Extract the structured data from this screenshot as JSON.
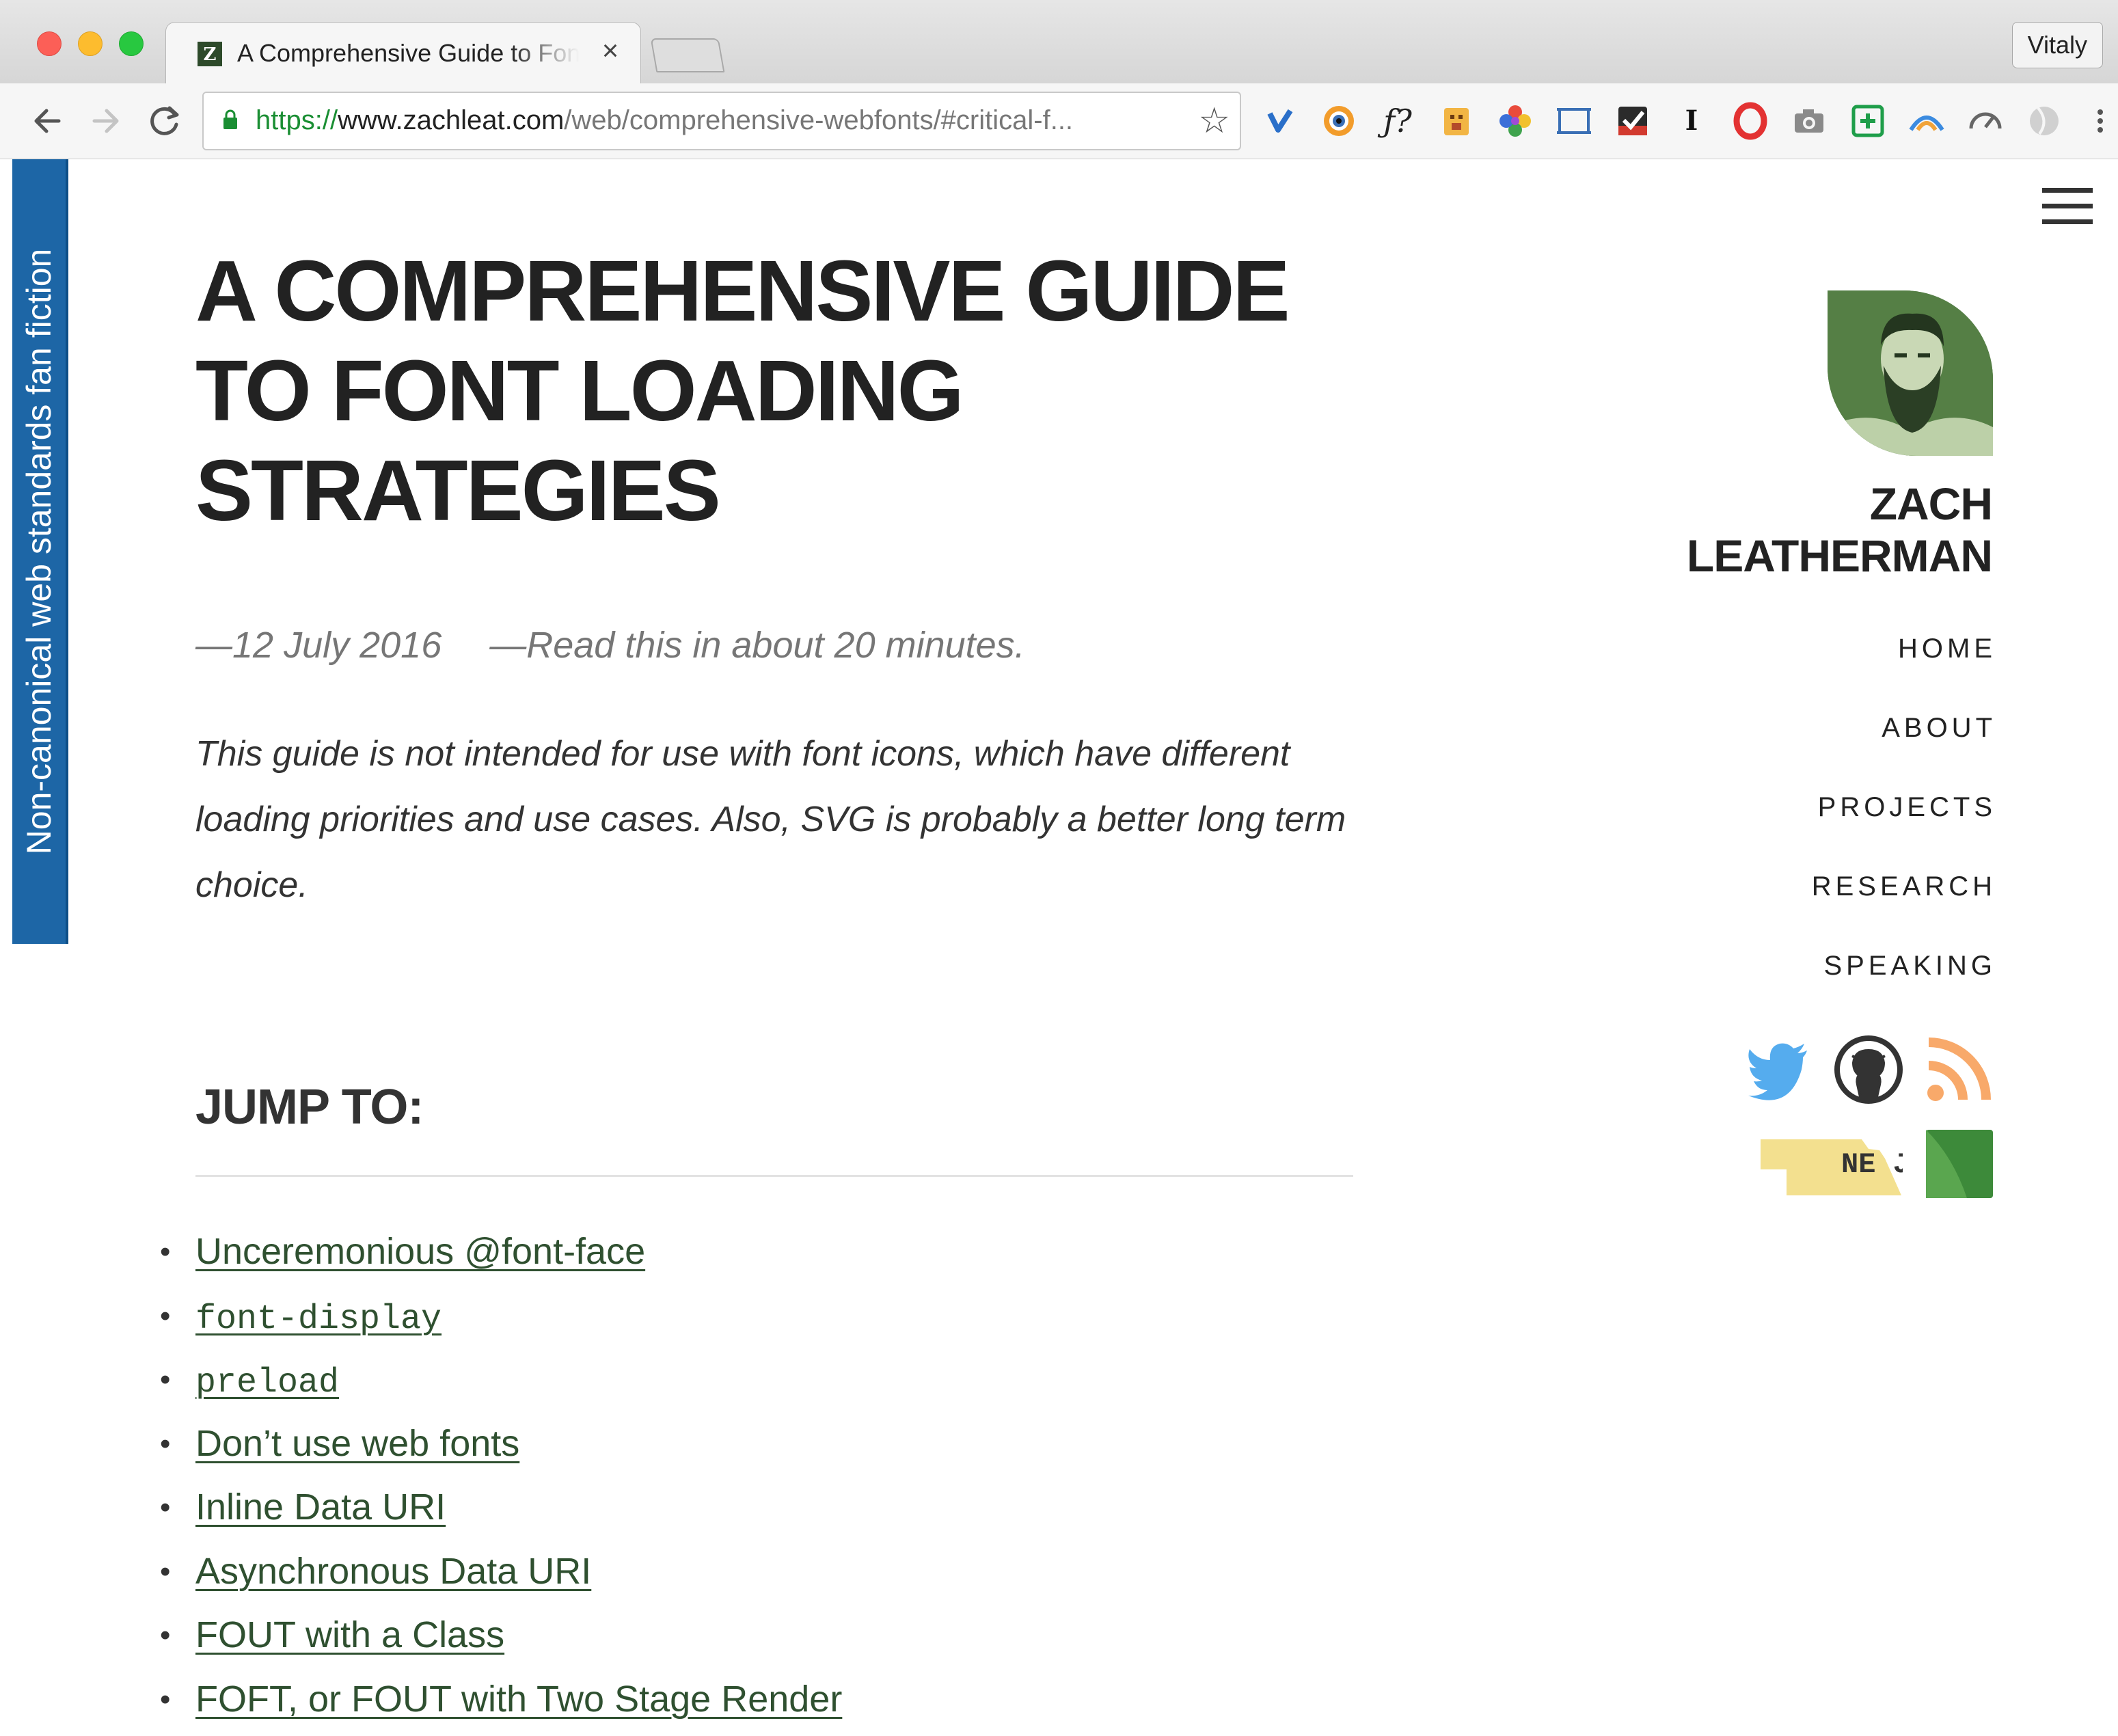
{
  "browser": {
    "tab_title": "A Comprehensive Guide to Font Loading Strategies",
    "tab_close_glyph": "×",
    "favicon_letter": "Z",
    "profile_name": "Vitaly",
    "url_scheme": "https://",
    "url_host": "www.zachleat.com",
    "url_path": "/web/comprehensive-webfonts/#critical-f...",
    "icons": [
      "back-arrow-icon",
      "forward-arrow-icon",
      "reload-icon",
      "lock-icon",
      "star-icon"
    ],
    "extensions": [
      "vimeo-icon",
      "eye-icon",
      "font-icon",
      "box-icon",
      "color-wheel-icon",
      "screenshot-frame-icon",
      "checkmark-icon",
      "text-cursor-icon",
      "opera-icon",
      "camera-icon",
      "plus-box-icon",
      "arc-icon",
      "speedometer-icon",
      "globe-icon",
      "more-menu-icon"
    ],
    "ext_font_label": "ƒ?"
  },
  "ribbon": {
    "text": "Non-canonical web standards fan fiction",
    "color": "#1d66a6"
  },
  "article": {
    "title": "A Comprehensive Guide to Font Loading Strategies",
    "date": "—12 July 2016",
    "reading_time": "—Read this in about 20 minutes.",
    "intro": "This guide is not intended for use with font icons, which have different loading priorities and use cases. Also, SVG is probably a better long term choice.",
    "jump_heading": "JUMP TO:",
    "jump_links": [
      {
        "label": "Unceremonious @font-face",
        "code": false
      },
      {
        "label": "font-display",
        "code": true
      },
      {
        "label": "preload",
        "code": true
      },
      {
        "label": "Don’t use web fonts",
        "code": false
      },
      {
        "label": "Inline Data URI",
        "code": false
      },
      {
        "label": "Asynchronous Data URI",
        "code": false
      },
      {
        "label": "FOUT with a Class",
        "code": false
      },
      {
        "label": "FOFT, or FOUT with Two Stage Render",
        "code": false
      }
    ],
    "bullet": "•",
    "link_color": "#2f5030"
  },
  "sidebar": {
    "author_first": "ZACH",
    "author_last": "LEATHERMAN",
    "nav": [
      "HOME",
      "ABOUT",
      "PROJECTS",
      "RESEARCH",
      "SPEAKING"
    ],
    "social": [
      "twitter-icon",
      "github-icon",
      "rss-icon",
      "nebraska-js-icon",
      "green-square-icon"
    ],
    "nebraska_label": "NE JS"
  },
  "colors": {
    "twitter": "#55acee",
    "github": "#333333",
    "rss": "#f8a96a",
    "nebraska": "#f3e08f",
    "green": "#3d8a3a"
  }
}
